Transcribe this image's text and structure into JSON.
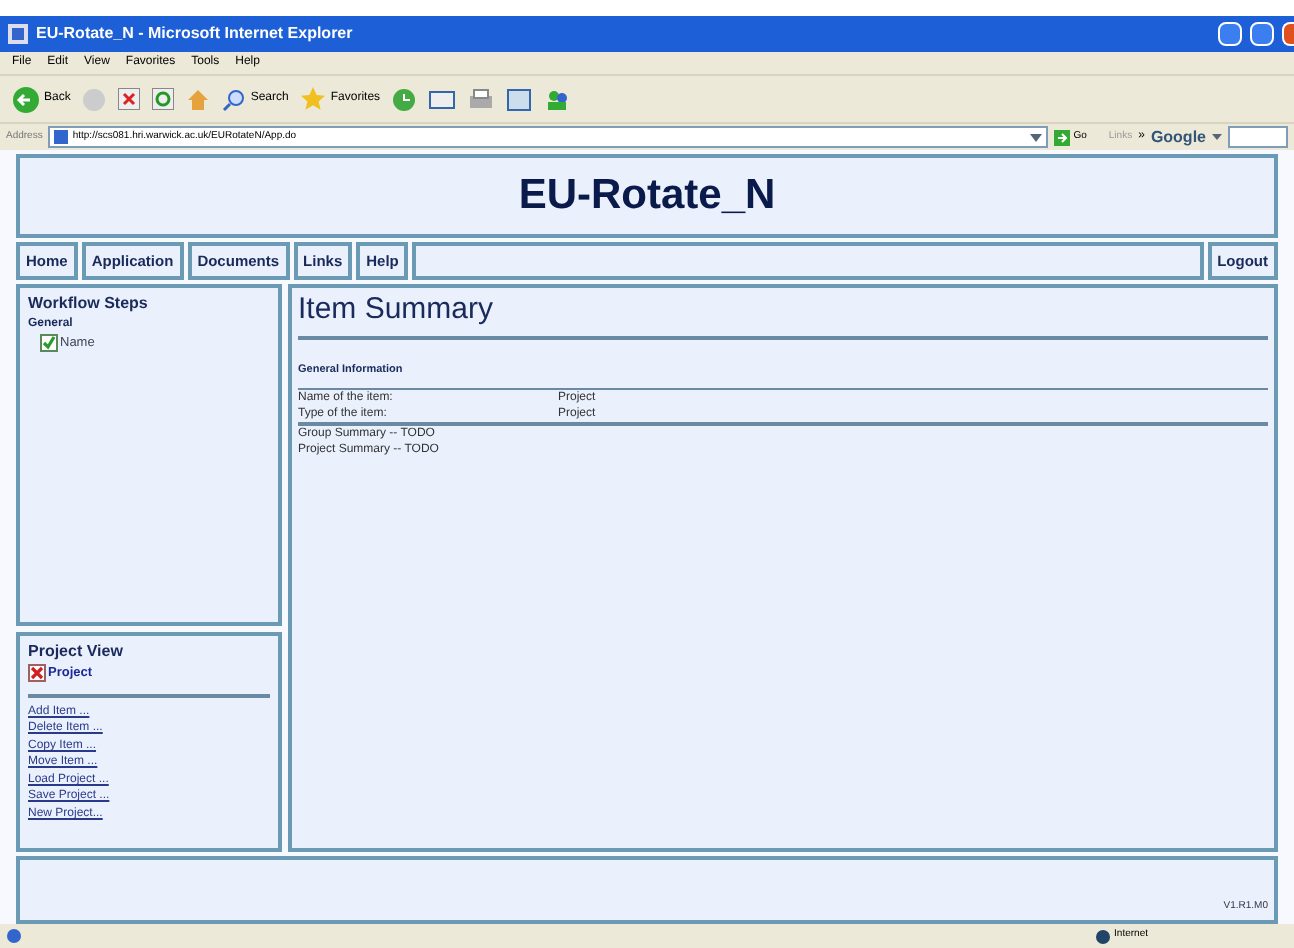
{
  "window": {
    "title": "EU-Rotate_N - Microsoft Internet Explorer"
  },
  "menu": [
    "File",
    "Edit",
    "View",
    "Favorites",
    "Tools",
    "Help"
  ],
  "toolbar": {
    "back": "Back",
    "search": "Search",
    "favorites": "Favorites"
  },
  "address": {
    "label": "Address",
    "url": "http://scs081.hri.warwick.ac.uk/EURotateN/App.do",
    "go": "Go",
    "links": "Links",
    "links_more": "»",
    "google": "Google"
  },
  "page": {
    "title": "EU-Rotate_N",
    "nav": [
      "Home",
      "Application",
      "Documents",
      "Links",
      "Help"
    ],
    "logout": "Logout",
    "workflow": {
      "title": "Workflow Steps",
      "groups": [
        {
          "name": "General",
          "steps": [
            {
              "name": "Name",
              "checked": true
            }
          ]
        }
      ]
    },
    "project_view": {
      "title": "Project View",
      "root": {
        "name": "Project",
        "checked": false
      },
      "actions": [
        "Add Item ...",
        "Delete Item ...",
        "Copy Item ...",
        "Move Item ...",
        "Load Project ...",
        "Save Project ...",
        "New Project..."
      ]
    },
    "content": {
      "title": "Item Summary",
      "section": "General Information",
      "rows": [
        {
          "label": "Name of the item:",
          "value": "Project"
        },
        {
          "label": "Type of the item:",
          "value": "Project"
        }
      ],
      "notes": [
        "Group Summary -- TODO",
        "Project Summary -- TODO"
      ]
    },
    "version": "V1.R1.M0"
  },
  "status_bar": {
    "zone": "Internet"
  }
}
